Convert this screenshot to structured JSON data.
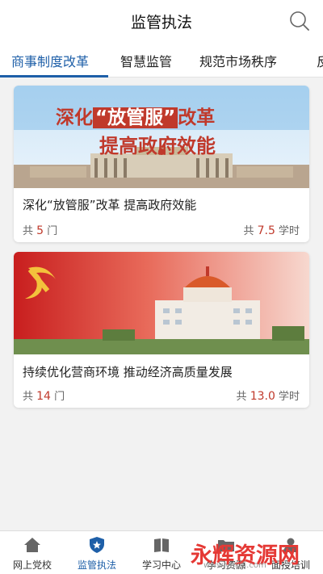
{
  "header": {
    "title": "监管执法",
    "search_icon": "search-icon"
  },
  "tabs": [
    {
      "label": "商事制度改革",
      "active": true
    },
    {
      "label": "智慧监管",
      "active": false
    },
    {
      "label": "规范市场秩序",
      "active": false
    },
    {
      "label": "反",
      "active": false
    }
  ],
  "courses": [
    {
      "banner_line1_a": "深化",
      "banner_line1_b": "“放管服”",
      "banner_line1_c": "改革",
      "banner_line2": "提高政府效能",
      "title": "深化“放管服”改革 提高政府效能",
      "count_prefix": "共 ",
      "count": "5",
      "count_suffix": " 门",
      "hours_prefix": "共 ",
      "hours": "7.5",
      "hours_suffix": " 学时"
    },
    {
      "title": "持续优化营商环境  推动经济高质量发展",
      "count_prefix": "共 ",
      "count": "14",
      "count_suffix": " 门",
      "hours_prefix": "共 ",
      "hours": "13.0",
      "hours_suffix": " 学时"
    }
  ],
  "bottom_nav": [
    {
      "label": "网上党校",
      "icon": "home-icon",
      "active": false
    },
    {
      "label": "监管执法",
      "icon": "shield-icon",
      "active": true
    },
    {
      "label": "学习中心",
      "icon": "book-icon",
      "active": false
    },
    {
      "label": "学习资源",
      "icon": "folder-icon",
      "active": false
    },
    {
      "label": "面授培训",
      "icon": "user-icon",
      "active": false
    }
  ],
  "watermark": {
    "logo": "永辉资源网",
    "url": "www.yhkjjj.com"
  },
  "colors": {
    "accent": "#1e5fa8",
    "highlight": "#c0392b",
    "background": "#f2f2f2"
  }
}
